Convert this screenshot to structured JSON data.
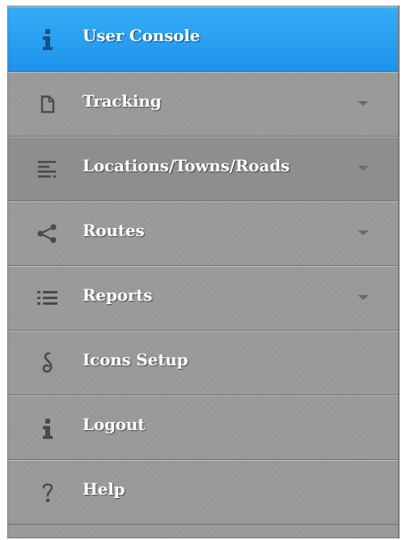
{
  "menu": {
    "items": [
      {
        "label": "User Console",
        "icon": "info-icon",
        "active": true,
        "has_submenu": false
      },
      {
        "label": "Tracking",
        "icon": "document-icon",
        "active": false,
        "has_submenu": true
      },
      {
        "label": "Locations/Towns/Roads",
        "icon": "lines-icon",
        "active": false,
        "has_submenu": true
      },
      {
        "label": "Routes",
        "icon": "share-icon",
        "active": false,
        "has_submenu": true
      },
      {
        "label": "Reports",
        "icon": "list-icon",
        "active": false,
        "has_submenu": true
      },
      {
        "label": "Icons Setup",
        "icon": "hook-icon",
        "active": false,
        "has_submenu": false
      },
      {
        "label": "Logout",
        "icon": "info-icon",
        "active": false,
        "has_submenu": false
      },
      {
        "label": "Help",
        "icon": "question-icon",
        "active": false,
        "has_submenu": false
      }
    ]
  },
  "colors": {
    "active_bg": "#2aa0f2",
    "panel_bg": "#9a9a9a",
    "icon_dark": "#4a4a4a",
    "icon_active": "#1b4f86",
    "text": "#ffffff"
  }
}
